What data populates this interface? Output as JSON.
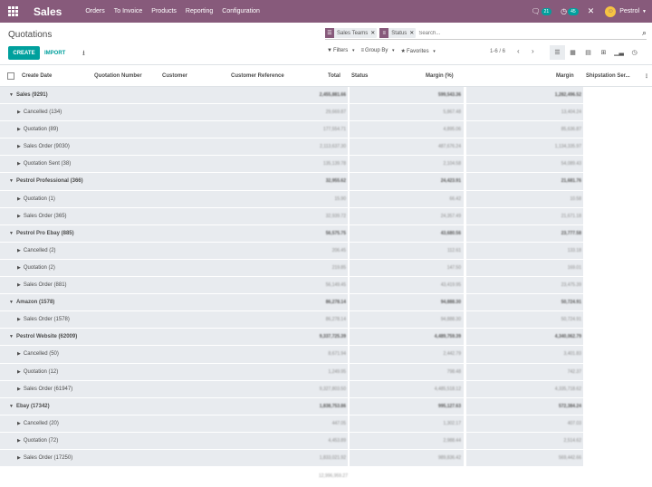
{
  "navbar": {
    "brand": "Sales",
    "menu": [
      "Orders",
      "To Invoice",
      "Products",
      "Reporting",
      "Configuration"
    ],
    "messages_count": "21",
    "activities_count": "45",
    "user_name": "Pestrol"
  },
  "control_panel": {
    "breadcrumb": "Quotations",
    "create_label": "CREATE",
    "import_label": "IMPORT",
    "facets": [
      {
        "label": "Sales Teams",
        "icon": "layers-icon"
      },
      {
        "label": "Status",
        "icon": "list-icon"
      }
    ],
    "search_placeholder": "Search...",
    "filters_label": "Filters",
    "groupby_label": "Group By",
    "favorites_label": "Favorites",
    "pager": "1-6 / 6"
  },
  "table": {
    "headers": {
      "create_date": "Create Date",
      "quotation_number": "Quotation Number",
      "customer": "Customer",
      "customer_reference": "Customer Reference",
      "total": "Total",
      "status": "Status",
      "margin_pct": "Margin (%)",
      "margin": "Margin",
      "shipstation": "Shipstation Ser..."
    },
    "rows": [
      {
        "level": 1,
        "label": "Sales (9291)",
        "total": "2,455,881.66",
        "margin_pct": "599,543.36",
        "margin": "1,282,496.52"
      },
      {
        "level": 2,
        "label": "Cancelled (134)",
        "total": "29,669.87",
        "margin_pct": "5,867.48",
        "margin": "13,404.24"
      },
      {
        "level": 2,
        "label": "Quotation (89)",
        "total": "177,554.71",
        "margin_pct": "4,895.06",
        "margin": "85,636.87"
      },
      {
        "level": 2,
        "label": "Sales Order (9030)",
        "total": "2,113,637.30",
        "margin_pct": "487,676.24",
        "margin": "1,134,335.97"
      },
      {
        "level": 2,
        "label": "Quotation Sent (38)",
        "total": "135,139.78",
        "margin_pct": "2,104.58",
        "margin": "54,089.43"
      },
      {
        "level": 1,
        "label": "Pestrol Professional (366)",
        "total": "32,955.62",
        "margin_pct": "24,423.91",
        "margin": "21,681.76"
      },
      {
        "level": 2,
        "label": "Quotation (1)",
        "total": "15.90",
        "margin_pct": "66.42",
        "margin": "10.58"
      },
      {
        "level": 2,
        "label": "Sales Order (365)",
        "total": "32,939.72",
        "margin_pct": "24,357.49",
        "margin": "21,671.18"
      },
      {
        "level": 1,
        "label": "Pestrol Pro Ebay (885)",
        "total": "56,575.75",
        "margin_pct": "43,680.56",
        "margin": "23,777.58"
      },
      {
        "level": 2,
        "label": "Cancelled (2)",
        "total": "206.45",
        "margin_pct": "112.61",
        "margin": "133.18"
      },
      {
        "level": 2,
        "label": "Quotation (2)",
        "total": "219.85",
        "margin_pct": "147.50",
        "margin": "169.01"
      },
      {
        "level": 2,
        "label": "Sales Order (881)",
        "total": "56,149.45",
        "margin_pct": "43,419.95",
        "margin": "23,475.39"
      },
      {
        "level": 1,
        "label": "Amazon (1578)",
        "total": "86,278.14",
        "margin_pct": "94,888.30",
        "margin": "50,724.91"
      },
      {
        "level": 2,
        "label": "Sales Order (1578)",
        "total": "86,278.14",
        "margin_pct": "94,888.30",
        "margin": "50,724.91"
      },
      {
        "level": 1,
        "label": "Pestrol Website (62009)",
        "total": "9,337,725.39",
        "margin_pct": "4,489,759.39",
        "margin": "4,340,062.79"
      },
      {
        "level": 2,
        "label": "Cancelled (50)",
        "total": "8,671.94",
        "margin_pct": "2,442.79",
        "margin": "3,401.83"
      },
      {
        "level": 2,
        "label": "Quotation (12)",
        "total": "1,249.95",
        "margin_pct": "798.48",
        "margin": "742.37"
      },
      {
        "level": 2,
        "label": "Sales Order (61947)",
        "total": "9,327,803.50",
        "margin_pct": "4,485,518.12",
        "margin": "4,335,718.62"
      },
      {
        "level": 1,
        "label": "Ebay (17342)",
        "total": "1,838,753.86",
        "margin_pct": "995,127.63",
        "margin": "572,384.24"
      },
      {
        "level": 2,
        "label": "Cancelled (20)",
        "total": "447.05",
        "margin_pct": "1,302.17",
        "margin": "407.03"
      },
      {
        "level": 2,
        "label": "Quotation (72)",
        "total": "4,453.89",
        "margin_pct": "2,988.44",
        "margin": "2,514.62"
      },
      {
        "level": 2,
        "label": "Sales Order (17250)",
        "total": "1,833,021.92",
        "margin_pct": "989,836.42",
        "margin": "569,442.66"
      }
    ],
    "grand_total": "12,996,959.27"
  }
}
